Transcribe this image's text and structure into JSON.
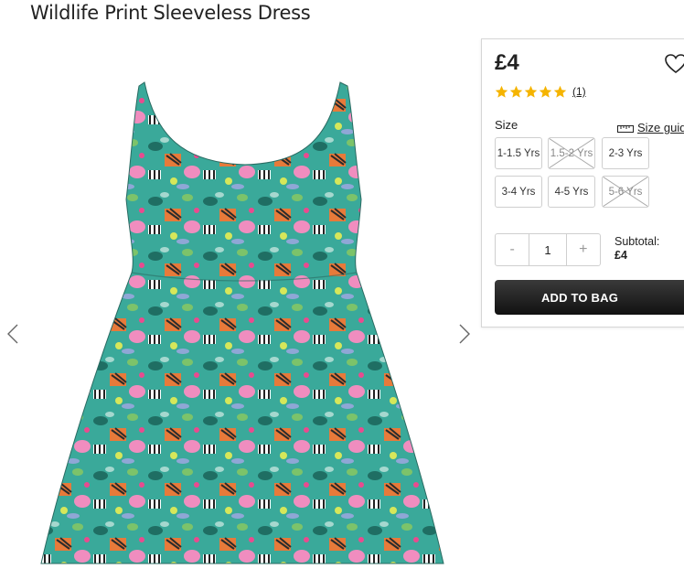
{
  "product": {
    "title": "Wildlife Print Sleeveless Dress",
    "image_alt": "Wildlife print sleeveless dress"
  },
  "buy_box": {
    "price": "£4",
    "rating": 5,
    "review_count": "(1)",
    "size_label": "Size",
    "size_guide_label": "Size guide",
    "sizes": [
      {
        "label": "1-1.5 Yrs",
        "available": true
      },
      {
        "label": "1.5-2 Yrs",
        "available": false
      },
      {
        "label": "2-3 Yrs",
        "available": true
      },
      {
        "label": "3-4 Yrs",
        "available": true
      },
      {
        "label": "4-5 Yrs",
        "available": true
      },
      {
        "label": "5-6 Yrs",
        "available": false
      }
    ],
    "quantity": {
      "minus": "-",
      "value": "1",
      "plus": "+"
    },
    "subtotal_label": "Subtotal:",
    "subtotal_value": "£4",
    "add_to_bag_label": "ADD TO BAG"
  },
  "colors": {
    "star": "#f5b400",
    "button_dark": "#1a1a1a",
    "dress_base": "#3aa99a"
  },
  "icons": {
    "wishlist": "heart-icon",
    "size_guide": "ruler-icon",
    "prev": "chevron-left-icon",
    "next": "chevron-right-icon",
    "rating": "star-icon"
  }
}
